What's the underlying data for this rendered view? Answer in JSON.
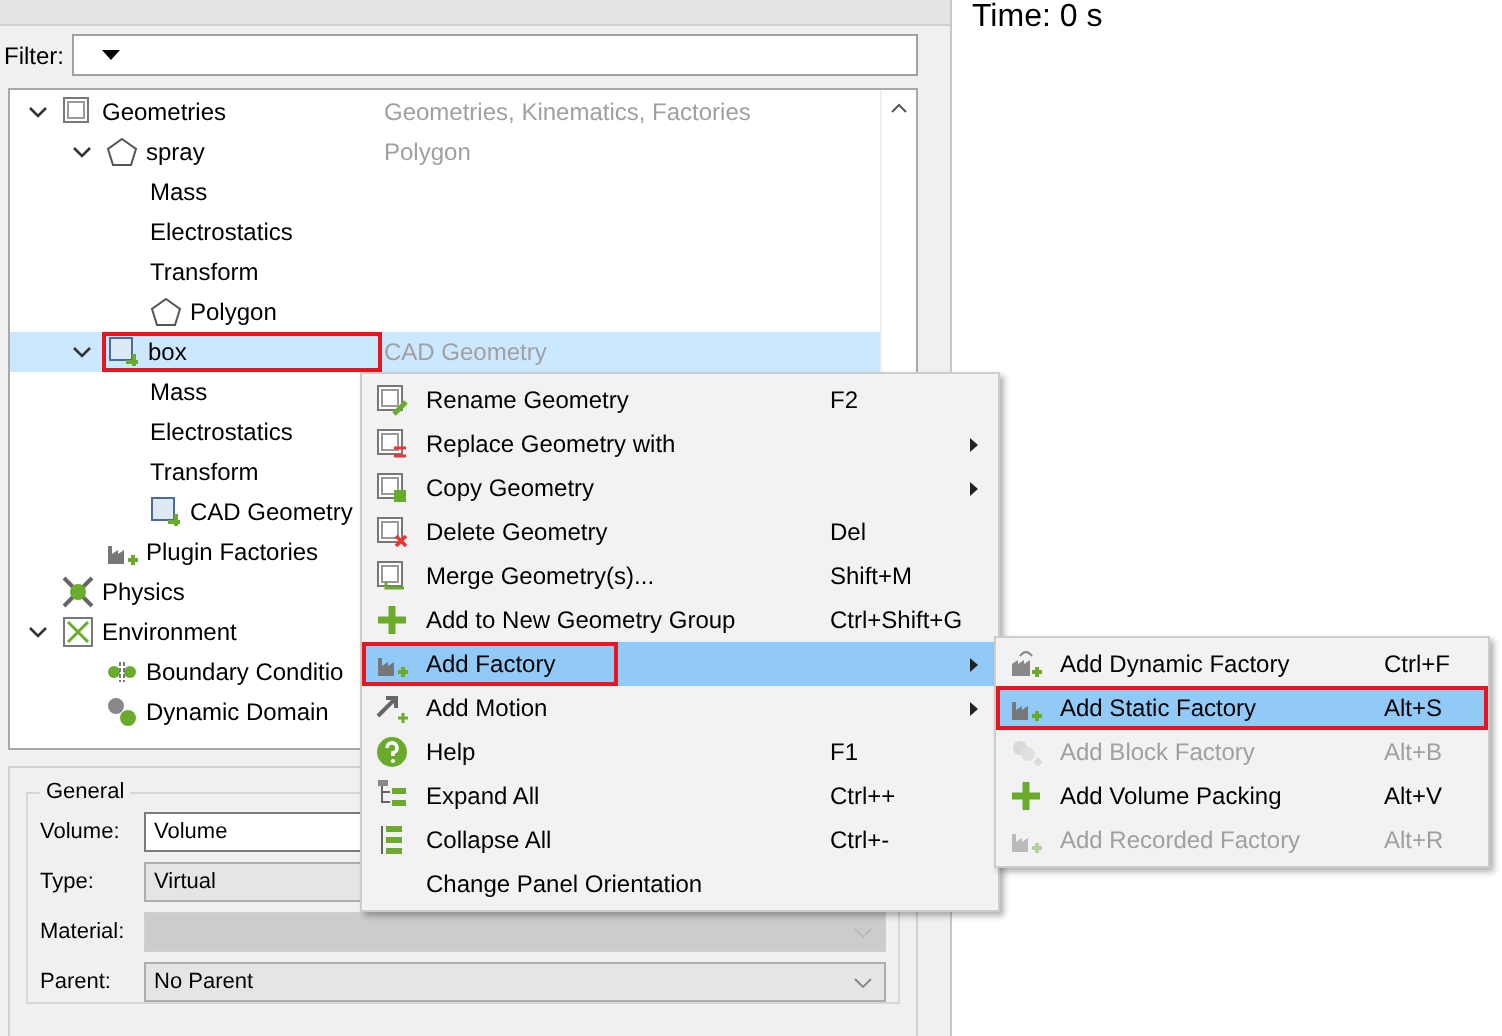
{
  "filter": {
    "label": "Filter:"
  },
  "tree": [
    {
      "label": "Geometries",
      "desc": "Geometries, Kinematics, Factories",
      "kind": "group",
      "expanded": true,
      "selected": false,
      "annotated": false,
      "children": [
        {
          "label": "spray",
          "desc": "Polygon",
          "kind": "polygon",
          "expanded": true,
          "selected": false,
          "annotated": false,
          "children": [
            {
              "label": "Mass",
              "kind": "property",
              "selected": false,
              "annotated": false
            },
            {
              "label": "Electrostatics",
              "kind": "property",
              "selected": false,
              "annotated": false
            },
            {
              "label": "Transform",
              "kind": "property",
              "selected": false,
              "annotated": false
            },
            {
              "label": "Polygon",
              "kind": "polygon",
              "selected": false,
              "annotated": false
            }
          ]
        },
        {
          "label": "box",
          "desc": "CAD Geometry",
          "kind": "cad",
          "expanded": true,
          "selected": true,
          "annotated": true,
          "children": [
            {
              "label": "Mass",
              "kind": "property",
              "selected": false,
              "annotated": false
            },
            {
              "label": "Electrostatics",
              "kind": "property",
              "selected": false,
              "annotated": false
            },
            {
              "label": "Transform",
              "kind": "property",
              "selected": false,
              "annotated": false
            },
            {
              "label": "CAD Geometry",
              "kind": "cad",
              "selected": false,
              "annotated": false
            }
          ]
        },
        {
          "label": "Plugin Factories",
          "kind": "factory",
          "selected": false,
          "annotated": false
        }
      ]
    },
    {
      "label": "Physics",
      "kind": "physics",
      "selected": false,
      "annotated": false
    },
    {
      "label": "Environment",
      "kind": "environment",
      "expanded": true,
      "selected": false,
      "annotated": false,
      "children": [
        {
          "label": "Boundary Conditio",
          "kind": "boundary",
          "selected": false,
          "annotated": false
        },
        {
          "label": "Dynamic Domain",
          "kind": "domain",
          "selected": false,
          "annotated": false
        }
      ]
    }
  ],
  "properties": {
    "title": "General",
    "fields": [
      {
        "label": "Volume:",
        "kind": "text",
        "value": "Volume",
        "disabled": false
      },
      {
        "label": "Type:",
        "kind": "select",
        "value": "Virtual",
        "disabled": false
      },
      {
        "label": "Material:",
        "kind": "select",
        "disabled": true
      },
      {
        "label": "Parent:",
        "kind": "select",
        "value": "No Parent",
        "disabled": false
      }
    ]
  },
  "time": "Time: 0 s",
  "context_menu": [
    {
      "label": "Rename Geometry",
      "shortcut": "F2",
      "kind": "rename",
      "submenu": false,
      "selected": false,
      "annotated": false
    },
    {
      "label": "Replace Geometry with",
      "kind": "replace",
      "submenu": true,
      "selected": false,
      "annotated": false
    },
    {
      "label": "Copy Geometry",
      "kind": "copy",
      "submenu": true,
      "selected": false,
      "annotated": false
    },
    {
      "label": "Delete Geometry",
      "shortcut": "Del",
      "kind": "delete",
      "submenu": false,
      "selected": false,
      "annotated": false
    },
    {
      "label": "Merge Geometry(s)...",
      "shortcut": "Shift+M",
      "kind": "merge",
      "submenu": false,
      "selected": false,
      "annotated": false
    },
    {
      "label": "Add to New Geometry Group",
      "shortcut": "Ctrl+Shift+G",
      "kind": "add",
      "submenu": false,
      "selected": false,
      "annotated": false
    },
    {
      "label": "Add Factory",
      "kind": "factory",
      "submenu": true,
      "selected": true,
      "annotated": true
    },
    {
      "label": "Add Motion",
      "kind": "motion",
      "submenu": true,
      "selected": false,
      "annotated": false
    },
    {
      "label": "Help",
      "shortcut": "F1",
      "kind": "help",
      "submenu": false,
      "selected": false,
      "annotated": false
    },
    {
      "label": "Expand All",
      "shortcut": "Ctrl++",
      "kind": "expand",
      "submenu": false,
      "selected": false,
      "annotated": false
    },
    {
      "label": "Collapse All",
      "shortcut": "Ctrl+-",
      "kind": "collapse",
      "submenu": false,
      "selected": false,
      "annotated": false
    },
    {
      "label": "Change Panel Orientation",
      "kind": "none",
      "submenu": false,
      "selected": false,
      "annotated": false
    }
  ],
  "submenu": [
    {
      "label": "Add Dynamic Factory",
      "shortcut": "Ctrl+F",
      "kind": "dynamic",
      "disabled": false,
      "selected": false,
      "annotated": false
    },
    {
      "label": "Add Static Factory",
      "shortcut": "Alt+S",
      "kind": "factory",
      "disabled": false,
      "selected": true,
      "annotated": true
    },
    {
      "label": "Add Block Factory",
      "shortcut": "Alt+B",
      "kind": "block",
      "disabled": true,
      "selected": false,
      "annotated": false
    },
    {
      "label": "Add Volume Packing",
      "shortcut": "Alt+V",
      "kind": "add",
      "disabled": false,
      "selected": false,
      "annotated": false
    },
    {
      "label": "Add Recorded Factory",
      "shortcut": "Alt+R",
      "kind": "factory",
      "disabled": true,
      "selected": false,
      "annotated": false
    }
  ]
}
